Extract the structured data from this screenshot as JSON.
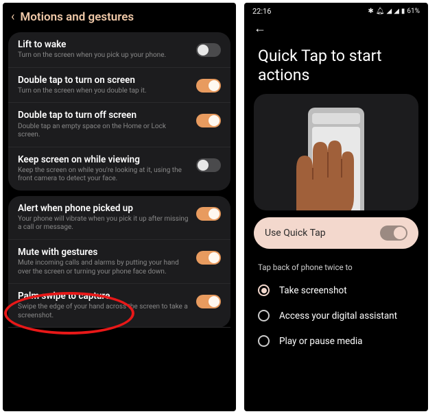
{
  "left": {
    "title": "Motions and gestures",
    "groups": [
      [
        {
          "title": "Lift to wake",
          "desc": "Turn on the screen when you pick up your phone.",
          "on": false
        },
        {
          "title": "Double tap to turn on screen",
          "desc": "Turn on the screen when you double tap it.",
          "on": true
        },
        {
          "title": "Double tap to turn off screen",
          "desc": "Double tap an empty space on the Home or Lock screen.",
          "on": true
        },
        {
          "title": "Keep screen on while viewing",
          "desc": "Keep the screen on while you're looking at it, using the front camera to detect your face.",
          "on": false
        }
      ],
      [
        {
          "title": "Alert when phone picked up",
          "desc": "Your phone will vibrate when you pick it up after missing a call or message.",
          "on": true
        },
        {
          "title": "Mute with gestures",
          "desc": "Mute incoming calls and alarms by putting your hand over the screen or turning your phone face down.",
          "on": true
        },
        {
          "title": "Palm swipe to capture",
          "desc": "Swipe the edge of your hand across the screen to take a screenshot.",
          "on": true,
          "highlight": true
        }
      ]
    ]
  },
  "right": {
    "status": {
      "time": "22:16",
      "battery": "61%"
    },
    "title": "Quick Tap to start actions",
    "mainToggle": {
      "label": "Use Quick Tap",
      "on": true
    },
    "sectionLabel": "Tap back of phone twice to",
    "options": [
      {
        "label": "Take screenshot",
        "selected": true
      },
      {
        "label": "Access your digital assistant",
        "selected": false
      },
      {
        "label": "Play or pause media",
        "selected": false
      }
    ]
  }
}
